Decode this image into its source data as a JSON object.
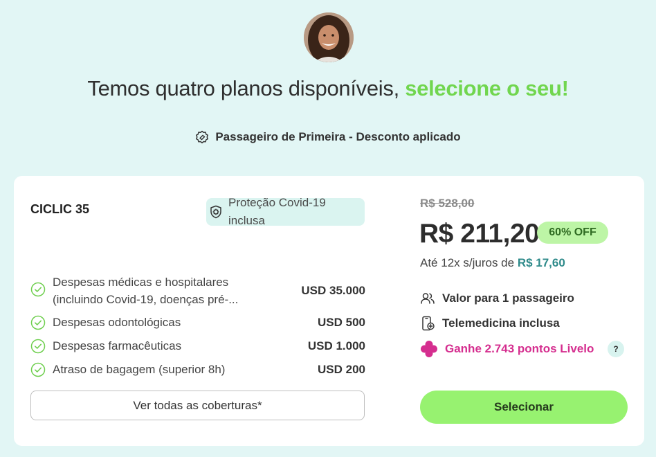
{
  "avatar": {
    "icon": "woman-avatar"
  },
  "headline": {
    "prefix": "Temos quatro planos disponíveis, ",
    "accent": "selecione o seu!"
  },
  "discount": {
    "icon": "discount-tag-icon",
    "label": "Passageiro de Primeira - Desconto aplicado"
  },
  "plan": {
    "name": "CICLIC 35",
    "covid_badge": "Proteção Covid-19 inclusa",
    "coverages": [
      {
        "label": "Despesas médicas e hospitalares (incluindo Covid-19, doenças pré-...",
        "value": "USD 35.000"
      },
      {
        "label": "Despesas odontológicas",
        "value": "USD 500"
      },
      {
        "label": "Despesas farmacêuticas",
        "value": "USD 1.000"
      },
      {
        "label": "Atraso de bagagem (superior 8h)",
        "value": "USD 200"
      }
    ],
    "see_all_label": "Ver todas as coberturas*",
    "old_price": "R$ 528,00",
    "price": "R$ 211,20",
    "off_badge": "60% OFF",
    "installments_prefix": "Até 12x s/juros de ",
    "installments_amount": "R$ 17,60",
    "features": {
      "passengers": "Valor para 1 passageiro",
      "telemedicine": "Telemedicina inclusa",
      "points": "Ganhe 2.743 pontos Livelo"
    },
    "help_label": "?",
    "select_label": "Selecionar"
  },
  "colors": {
    "background": "#e2f6f5",
    "accent_green": "#71d64f",
    "button_green": "#97f270",
    "livelo_pink": "#d52e8f",
    "teal_amount": "#2e8a8a"
  }
}
